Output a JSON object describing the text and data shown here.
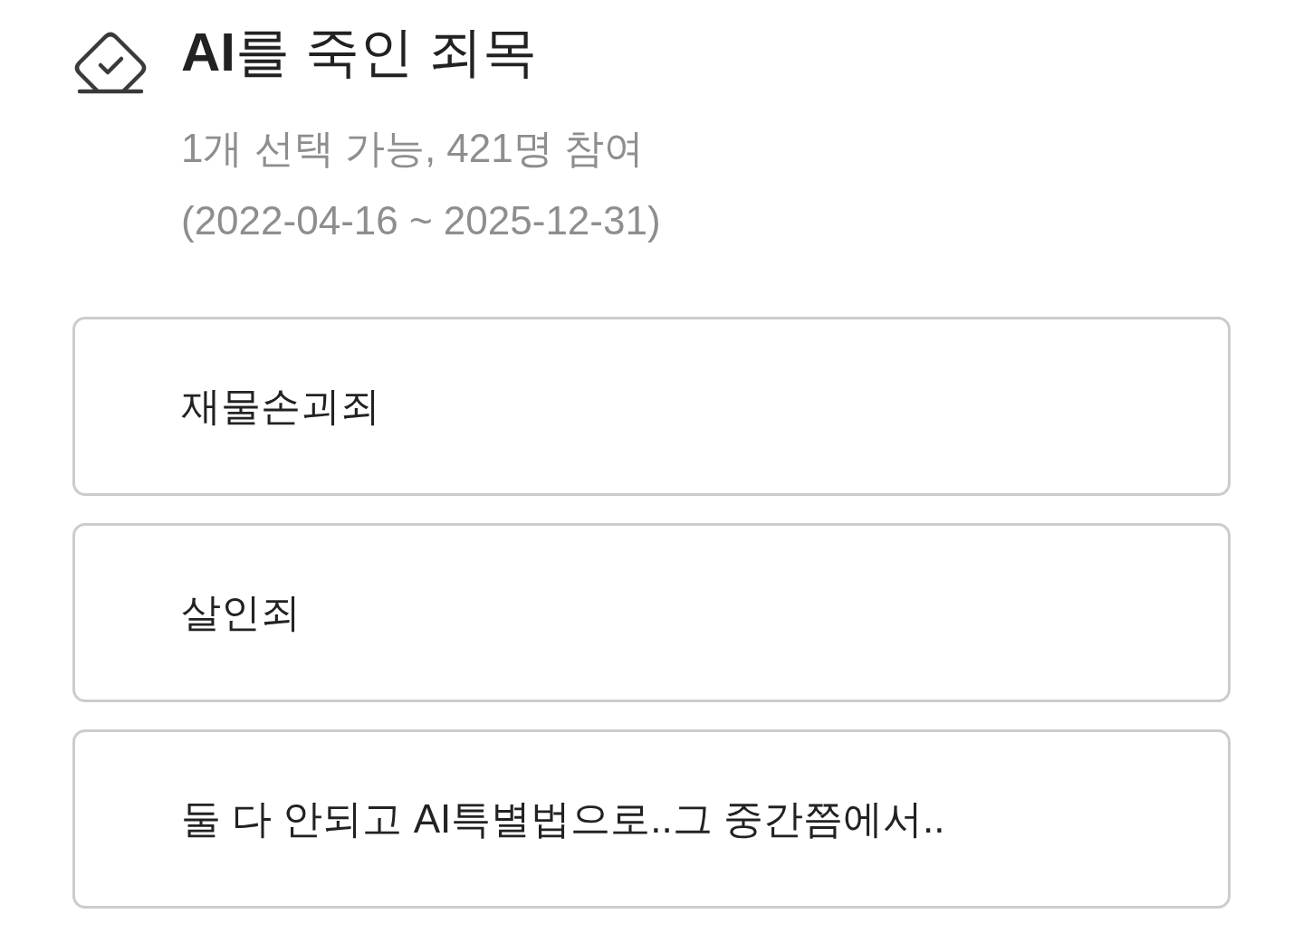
{
  "poll": {
    "title": "**AI**를 죽인 죄목",
    "info": "1개 선택 가능, 421명 참여",
    "period": "(2022-04-16 ~ 2025-12-31)"
  },
  "options": [
    {
      "label": "재물손괴죄",
      "selected": false
    },
    {
      "label": "살인죄",
      "selected": false
    },
    {
      "label": "둘 다 안되고 AI특별법으로..그 중간쯤에서..",
      "selected": false
    }
  ]
}
